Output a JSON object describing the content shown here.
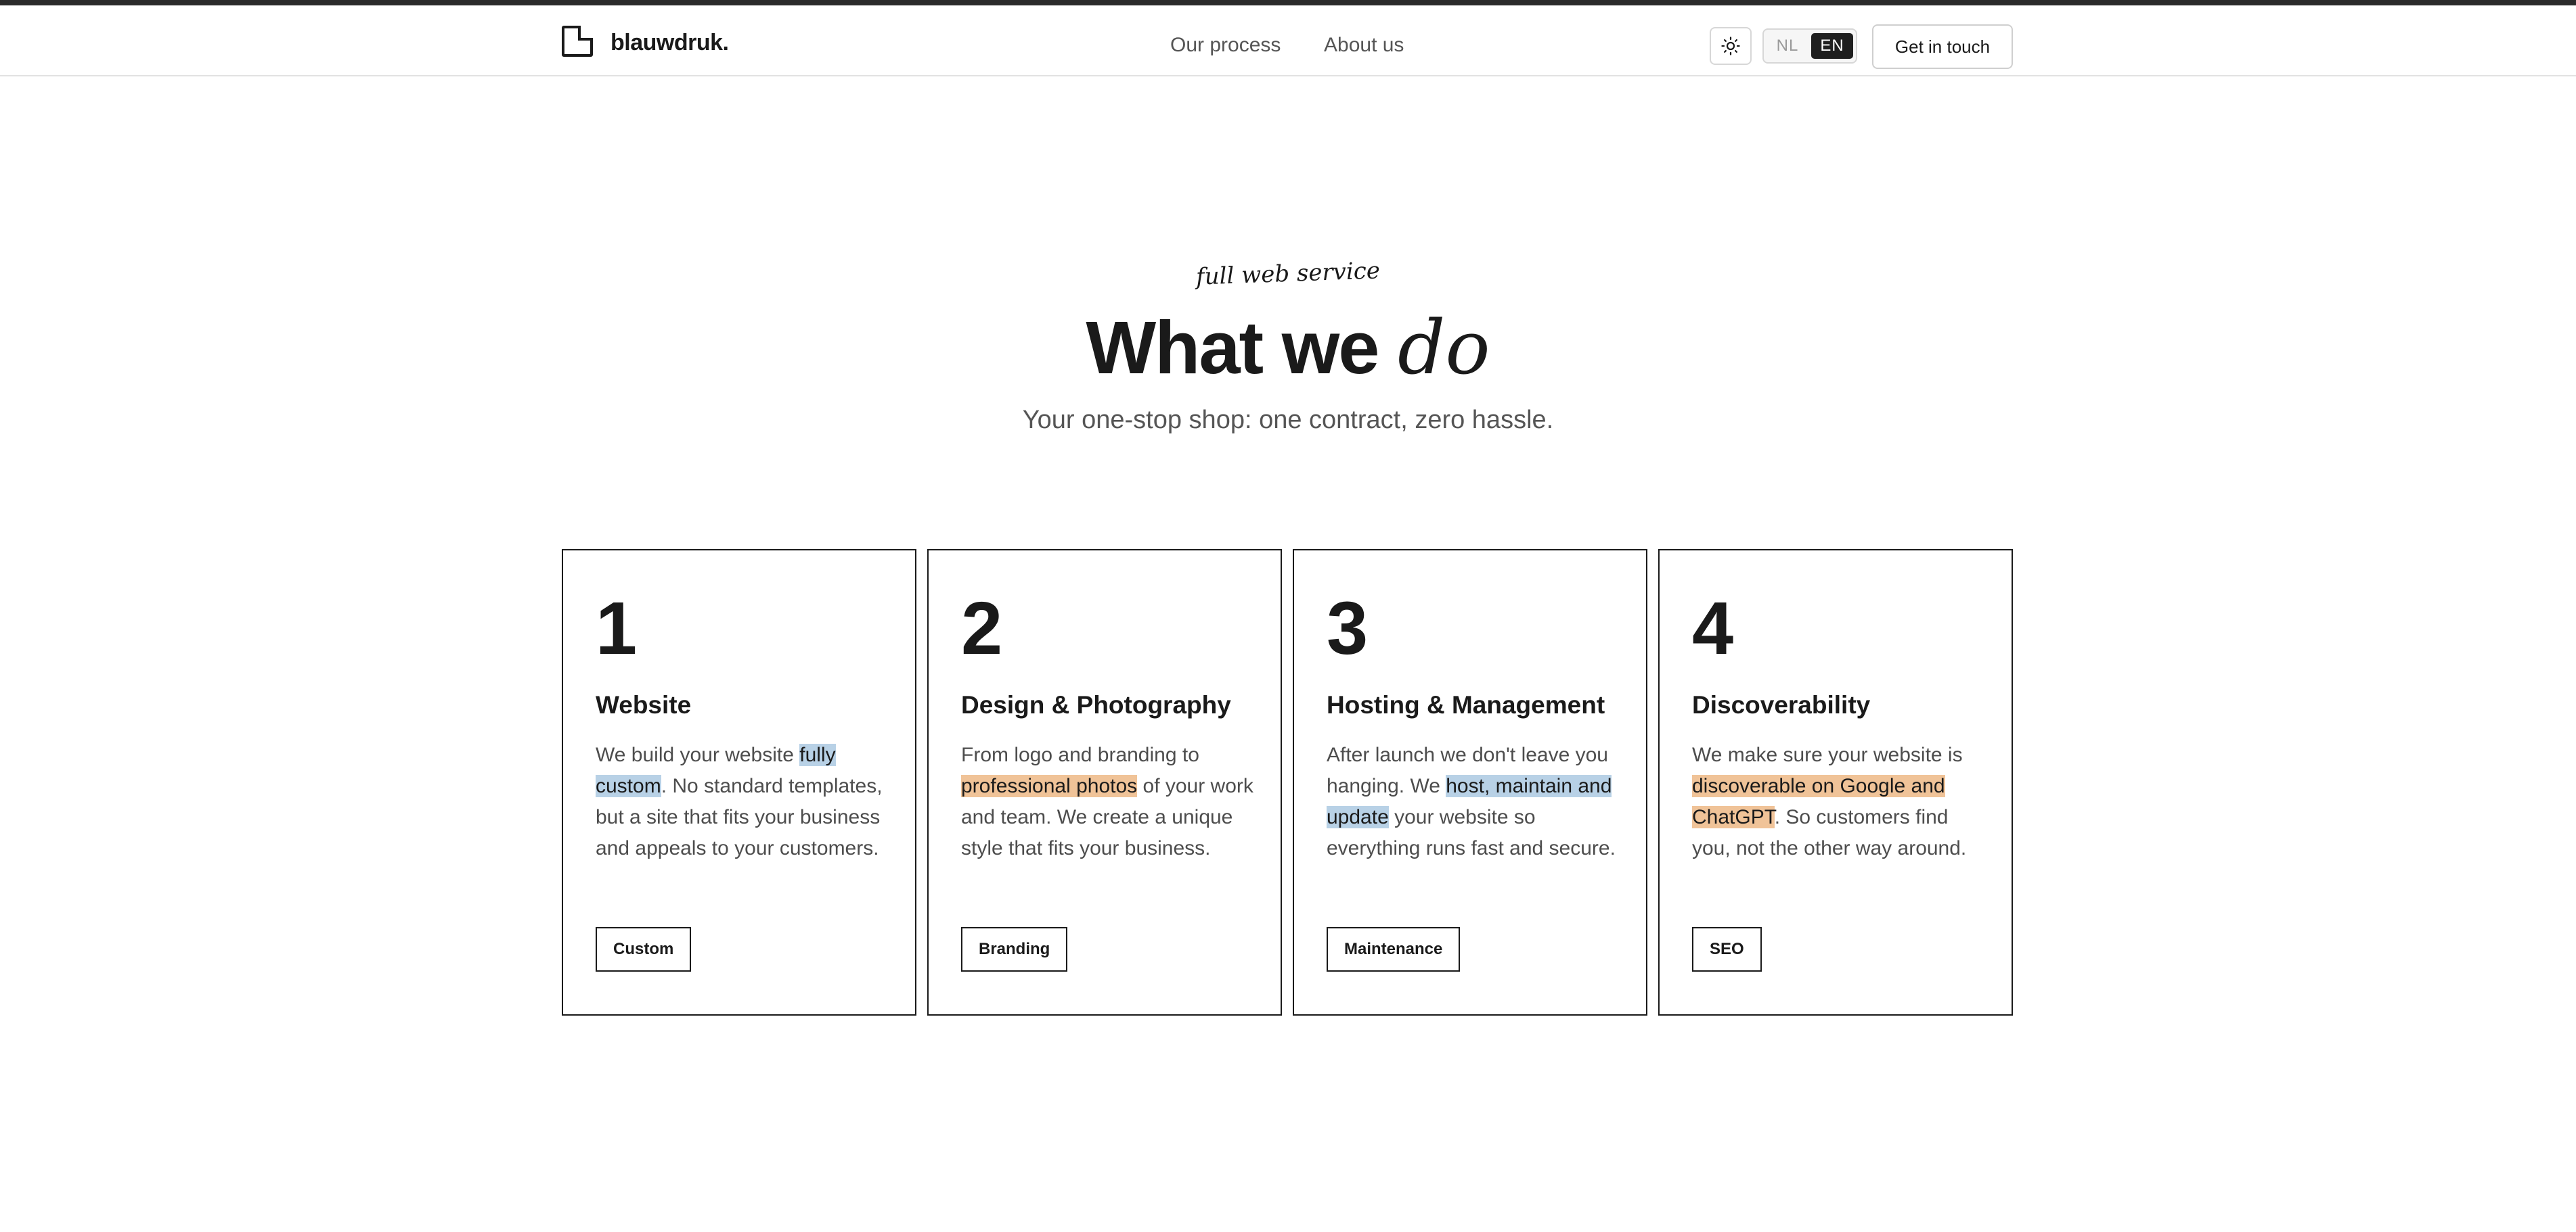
{
  "nav": {
    "brand": "blauwdruk.",
    "links": [
      "Our process",
      "About us"
    ],
    "languages": [
      "NL",
      "EN"
    ],
    "active_language": "EN",
    "cta": "Get in touch"
  },
  "hero": {
    "eyebrow": "full web service",
    "title_plain": "What we",
    "title_italic": "do",
    "subtitle": "Your one-stop shop: one contract, zero hassle."
  },
  "cards": [
    {
      "number": "1",
      "title": "Website",
      "desc_1": "We build your website ",
      "desc_hl": "fully custom",
      "desc_2": ". No standard templates, but a site that fits your business and appeals to your customers.",
      "tag": "Custom"
    },
    {
      "number": "2",
      "title": "Design & Photography",
      "desc_1": "From logo and branding to ",
      "desc_hl": "professional photos",
      "desc_2": " of your work and team. We create a unique style that fits your business.",
      "tag": "Branding"
    },
    {
      "number": "3",
      "title": "Hosting & Management",
      "desc_1": "After launch we don't leave you hanging. We ",
      "desc_hl": "host, maintain and update",
      "desc_2": " your website so everything runs fast and secure.",
      "tag": "Maintenance"
    },
    {
      "number": "4",
      "title": "Discoverability",
      "desc_1": "We make sure your website is ",
      "desc_hl": "discoverable on Google and ChatGPT",
      "desc_2": ". So customers find you, not the other way around.",
      "tag": "SEO"
    }
  ],
  "colors": {
    "highlight_blue": "#b8d1e6",
    "highlight_orange": "#f0c398",
    "ink": "#1a1a1a"
  }
}
